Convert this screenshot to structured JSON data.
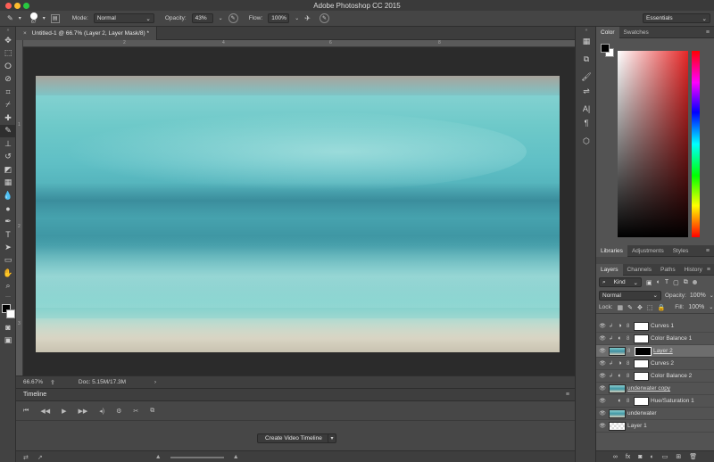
{
  "app": {
    "title": "Adobe Photoshop CC 2015"
  },
  "options": {
    "brush_size": "67",
    "mode_label": "Mode:",
    "mode_value": "Normal",
    "opacity_label": "Opacity:",
    "opacity_value": "43%",
    "flow_label": "Flow:",
    "flow_value": "100%",
    "workspace": "Essentials"
  },
  "document": {
    "tab_label": "Untitled-1 @ 66.7% (Layer 2, Layer Mask/8) *",
    "zoom": "66.67%",
    "doc_info": "Doc: 5.15M/17.3M"
  },
  "timeline": {
    "title": "Timeline",
    "create_button": "Create Video Timeline"
  },
  "color_panel": {
    "tabs": [
      "Color",
      "Swatches"
    ]
  },
  "libraries_panel": {
    "tabs": [
      "Libraries",
      "Adjustments",
      "Styles"
    ]
  },
  "layers_panel": {
    "tabs": [
      "Layers",
      "Channels",
      "Paths",
      "History"
    ],
    "filter_kind": "Kind",
    "blend_mode": "Normal",
    "opacity_label": "Opacity:",
    "opacity_value": "100%",
    "lock_label": "Lock:",
    "fill_label": "Fill:",
    "fill_value": "100%",
    "layers": [
      {
        "name": "Curves 1",
        "type": "curves",
        "clipped": true
      },
      {
        "name": "Color Balance 1",
        "type": "balance",
        "clipped": true
      },
      {
        "name": "Layer 2",
        "type": "pixel-mask",
        "selected": true
      },
      {
        "name": "Curves 2",
        "type": "curves",
        "clipped": true
      },
      {
        "name": "Color Balance 2",
        "type": "balance",
        "clipped": true
      },
      {
        "name": "underwater copy",
        "type": "pixel"
      },
      {
        "name": "Hue/Saturation 1",
        "type": "huesat"
      },
      {
        "name": "underwater",
        "type": "pixel"
      },
      {
        "name": "Layer 1",
        "type": "transparent"
      }
    ]
  },
  "rulers": {
    "top": [
      "2",
      "4",
      "6",
      "8"
    ],
    "left": [
      "1",
      "2",
      "3"
    ]
  },
  "colors": {
    "accent": "#e52727",
    "selection": "#6d6d6d"
  }
}
